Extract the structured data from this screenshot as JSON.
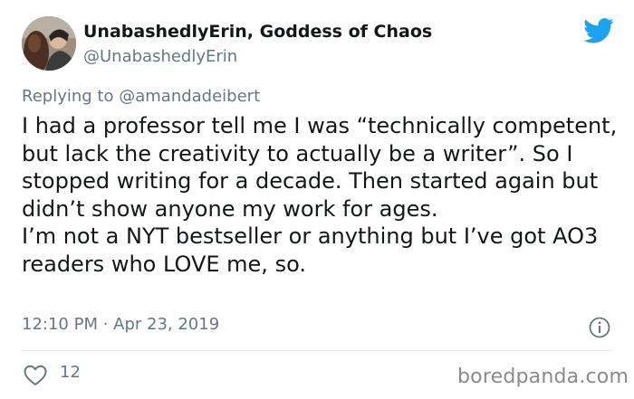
{
  "author": {
    "display_name": "UnabashedlyErin, Goddess of Chaos",
    "handle": "@UnabashedlyErin",
    "avatar": "avatar-photo"
  },
  "brand_icon": "twitter-bird-icon",
  "colors": {
    "twitter_blue": "#1da1f2",
    "secondary_text": "#657786",
    "primary_text": "#14171a",
    "divider": "#e1e8ed"
  },
  "reply": {
    "prefix": "Replying to",
    "mention": "@amandadeibert"
  },
  "tweet": {
    "paragraphs": [
      "I had a professor tell me I was “technically competent, but lack the creativity to actually be a writer”. So I stopped writing for a decade. Then started again but didn’t show anyone my work for ages.",
      "I’m not a NYT bestseller or anything but I’ve got AO3 readers who LOVE me, so."
    ]
  },
  "meta": {
    "timestamp": "12:10 PM · Apr 23, 2019",
    "info_icon": "info-icon"
  },
  "actions": {
    "like_icon": "heart-icon",
    "like_count": "12"
  },
  "watermark": "boredpanda.com"
}
